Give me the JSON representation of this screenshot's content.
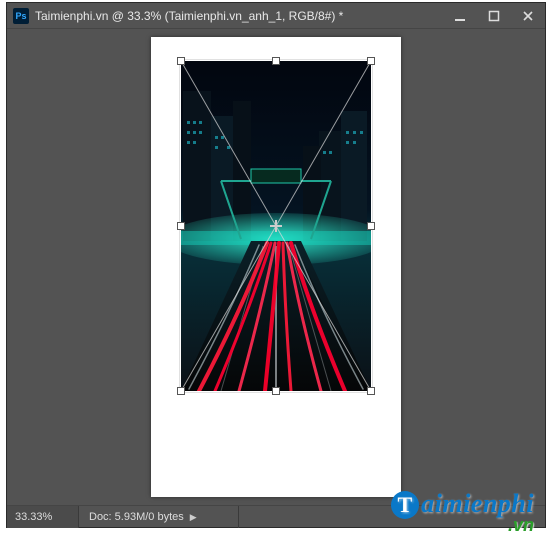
{
  "window": {
    "app_icon_text": "Ps",
    "title": "Taimienphi.vn @ 33.3% (Taimienphi.vn_anh_1, RGB/8#) *"
  },
  "status": {
    "zoom": "33.33%",
    "doc_info": "Doc: 5.93M/0 bytes"
  },
  "watermark": {
    "brand": "aimienphi",
    "brand_cap": "T",
    "tld": ".vn"
  }
}
